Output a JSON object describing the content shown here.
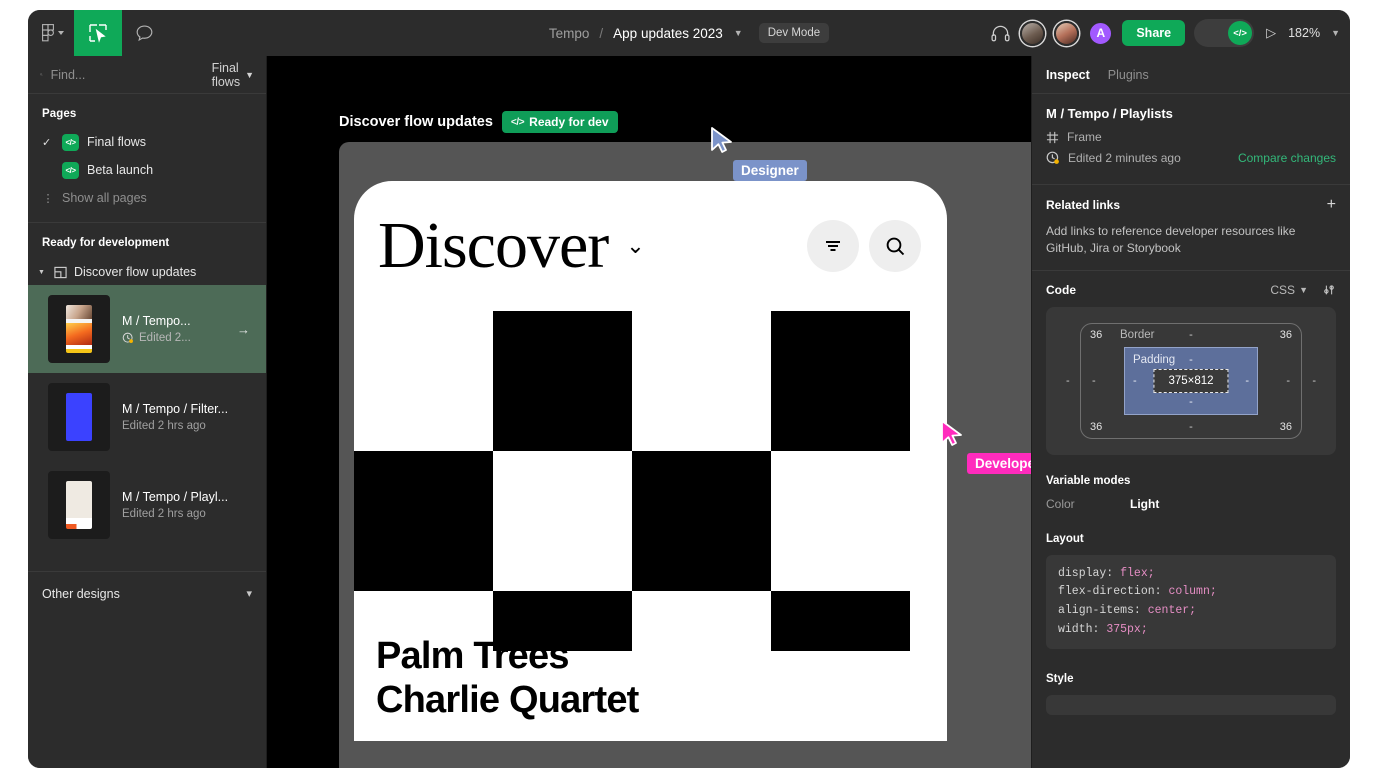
{
  "topbar": {
    "logo_icon": "figma-logo-icon",
    "logo_caret_icon": "chevron-down-icon",
    "tool_icon": "inspect-cursor-icon",
    "comment_icon": "comment-bubble-icon",
    "project_name": "Tempo",
    "separator": "/",
    "file_name": "App updates 2023",
    "file_chevron_icon": "chevron-down-icon",
    "mode_badge": "Dev Mode",
    "headphones_icon": "headphones-icon",
    "avatars": [
      {
        "name": "avatar-user-1",
        "initial": ""
      },
      {
        "name": "avatar-user-2",
        "initial": ""
      },
      {
        "name": "avatar-user-3",
        "initial": "A",
        "color": "#a259ff"
      }
    ],
    "share_label": "Share",
    "devmode_toggle_icon": "code-brackets-icon",
    "play_icon": "play-triangle-icon",
    "zoom_level": "182%",
    "zoom_chevron_icon": "chevron-down-icon"
  },
  "sidebar": {
    "search": {
      "placeholder": "Find...",
      "icon": "search-icon"
    },
    "flow_filter": {
      "label": "Final flows",
      "icon": "chevron-down-icon"
    },
    "pages_title": "Pages",
    "pages": [
      {
        "label": "Final flows",
        "checked": true,
        "badge": "</>"
      },
      {
        "label": "Beta launch",
        "checked": false,
        "badge": "</>"
      }
    ],
    "show_all_pages": "Show all pages",
    "ready_title": "Ready for development",
    "group": {
      "label": "Discover flow updates",
      "expanded": true
    },
    "nodes": [
      {
        "name": "M / Tempo...",
        "meta": "Edited 2...",
        "selected": true,
        "has_clock": true,
        "arrow": "→"
      },
      {
        "name": "M / Tempo / Filter...",
        "meta": "Edited 2 hrs ago",
        "selected": false,
        "has_clock": false
      },
      {
        "name": "M / Tempo / Playl...",
        "meta": "Edited 2 hrs ago",
        "selected": false,
        "has_clock": false
      }
    ],
    "other_designs": {
      "label": "Other designs",
      "icon": "chevron-down-icon"
    }
  },
  "canvas": {
    "frame_name": "Discover flow updates",
    "ready_badge": {
      "icon": "</>",
      "label": "Ready for dev"
    },
    "mockup": {
      "header_title": "Discover",
      "header_chevron_icon": "chevron-down-icon",
      "filter_icon": "filter-lines-icon",
      "search_icon": "search-icon",
      "card_title": "Palm Trees",
      "card_subtitle": "Charlie Quartet"
    },
    "cursors": [
      {
        "label": "Designer",
        "color": "#7b93c9"
      },
      {
        "label": "Developer",
        "color": "#ff2bbd"
      }
    ]
  },
  "inspect": {
    "tabs": [
      {
        "label": "Inspect",
        "active": true
      },
      {
        "label": "Plugins",
        "active": false
      }
    ],
    "node_title": "M / Tempo / Playlists",
    "node_type": "Frame",
    "node_type_icon": "frame-hash-icon",
    "edited": "Edited 2 minutes ago",
    "edited_icon": "clock-history-icon",
    "compare_changes": "Compare changes",
    "related_links": {
      "title": "Related links",
      "add_icon": "plus-icon",
      "description": "Add links to reference developer resources like GitHub, Jira or Storybook"
    },
    "code": {
      "title": "Code",
      "language": "CSS",
      "language_chevron_icon": "chevron-down-icon",
      "settings_icon": "sliders-icon",
      "box_model": {
        "border_label": "Border",
        "padding_label": "Padding",
        "size": "375×812",
        "corner_top_left": "36",
        "corner_top_right": "36",
        "corner_bottom_left": "36",
        "corner_bottom_right": "36",
        "dash": "-"
      }
    },
    "variable_modes": {
      "title": "Variable modes",
      "rows": [
        {
          "key": "Color",
          "value": "Light"
        }
      ]
    },
    "layout": {
      "title": "Layout",
      "lines": [
        {
          "prop": "display:",
          "value": "flex;"
        },
        {
          "prop": "flex-direction:",
          "value": "column;"
        },
        {
          "prop": "align-items:",
          "value": "center;"
        },
        {
          "prop": "width:",
          "value": "375px;"
        }
      ]
    },
    "style": {
      "title": "Style"
    }
  }
}
